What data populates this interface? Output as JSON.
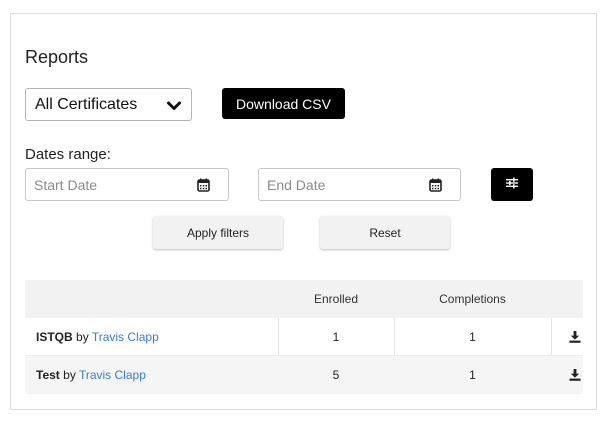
{
  "page": {
    "title": "Reports"
  },
  "filters": {
    "certificate_select": "All Certificates",
    "download_label": "Download CSV",
    "dates_label": "Dates range:",
    "start_placeholder": "Start Date",
    "end_placeholder": "End Date",
    "apply_label": "Apply filters",
    "reset_label": "Reset"
  },
  "table": {
    "headers": {
      "name": "",
      "enrolled": "Enrolled",
      "completions": "Completions"
    },
    "rows": [
      {
        "course": "ISTQB",
        "by": "by",
        "author": "Travis Clapp",
        "enrolled": "1",
        "completions": "1"
      },
      {
        "course": "Test",
        "by": "by",
        "author": "Travis Clapp",
        "enrolled": "5",
        "completions": "1"
      }
    ]
  },
  "icons": {
    "select": "chevron-down-icon",
    "date": "calendar-icon",
    "filter": "sliders-icon",
    "download": "download-icon"
  },
  "colors": {
    "accent_dark": "#000000",
    "link": "#3a7bd5",
    "header_bg": "#f2f2f2"
  }
}
